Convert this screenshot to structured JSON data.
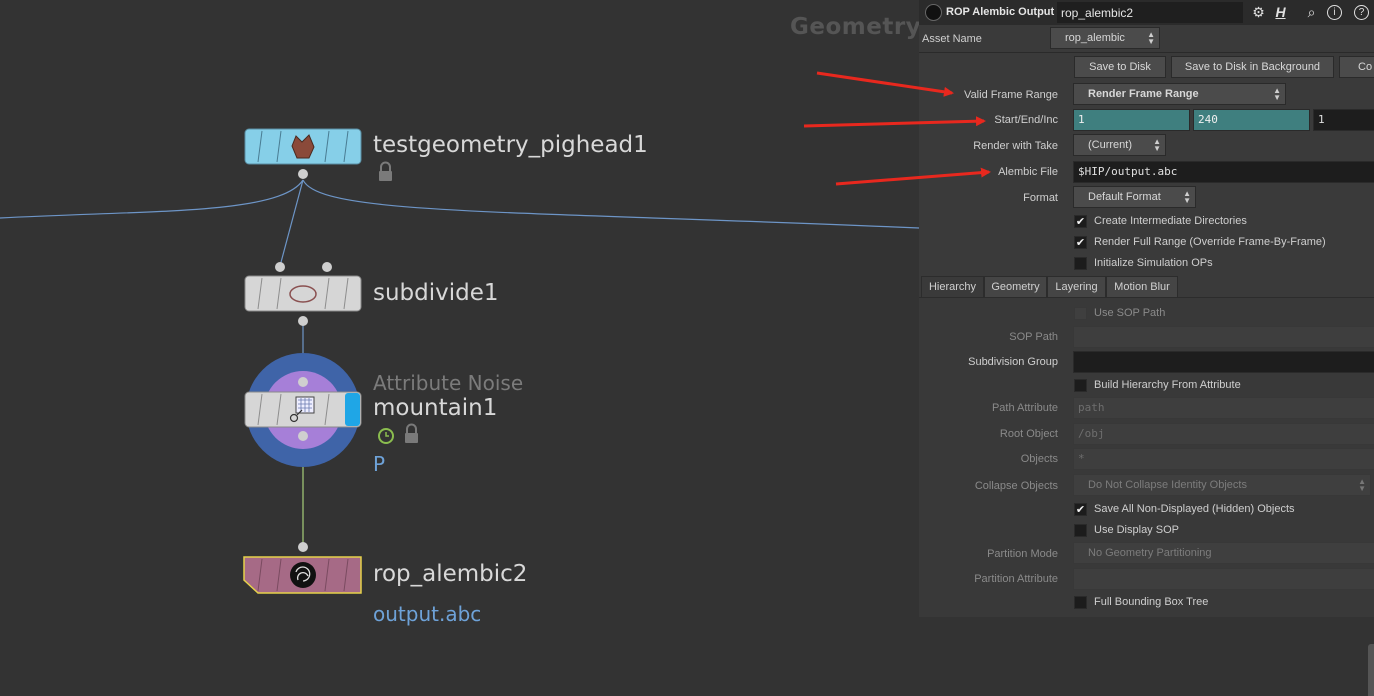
{
  "network": {
    "context": "Geometry",
    "nodes": {
      "pighead": {
        "name": "testgeometry_pighead1"
      },
      "subdivide": {
        "name": "subdivide1"
      },
      "mountain": {
        "type_label": "Attribute Noise",
        "name": "mountain1",
        "extra": "P"
      },
      "rop": {
        "name": "rop_alembic2",
        "extra": "output.abc"
      }
    },
    "colors": {
      "pighead_node": "#86cfe8",
      "default_node": "#d6d6d6",
      "rop_node": "#a66a86",
      "wire": "#6d95c7",
      "noise_ring_outer": "#3f64a8",
      "noise_ring_inner": "#a67fd8"
    }
  },
  "panel": {
    "header": {
      "type_label": "ROP Alembic Output",
      "node_name": "rop_alembic2"
    },
    "asset": {
      "label": "Asset Name",
      "value": "rop_alembic"
    },
    "buttons": {
      "save_to_disk": "Save to Disk",
      "save_background": "Save to Disk in Background",
      "controls": "Co"
    },
    "valid_frame_range": {
      "label": "Valid Frame Range",
      "value": "Render Frame Range"
    },
    "start_end_inc": {
      "label": "Start/End/Inc",
      "start": "1",
      "end": "240",
      "inc": "1"
    },
    "render_with_take": {
      "label": "Render with Take",
      "value": "(Current)"
    },
    "alembic_file": {
      "label": "Alembic File",
      "value": "$HIP/output.abc"
    },
    "format": {
      "label": "Format",
      "value": "Default Format"
    },
    "toggles": [
      {
        "label": "Create Intermediate Directories",
        "checked": true
      },
      {
        "label": "Render Full Range (Override Frame-By-Frame)",
        "checked": true
      },
      {
        "label": "Initialize Simulation OPs",
        "checked": false
      }
    ],
    "tabs": [
      "Hierarchy",
      "Geometry",
      "Layering",
      "Motion Blur"
    ],
    "hierarchy": {
      "use_sop_path": "Use SOP Path",
      "sop_path": "SOP Path",
      "subdivision_group": "Subdivision Group",
      "build_hierarchy": "Build Hierarchy From Attribute",
      "path_attribute": {
        "label": "Path Attribute",
        "value": "path"
      },
      "root_object": {
        "label": "Root Object",
        "value": "/obj"
      },
      "objects": {
        "label": "Objects",
        "value": "*"
      },
      "collapse_objects": {
        "label": "Collapse Objects",
        "value": "Do Not Collapse Identity Objects"
      },
      "save_hidden": "Save All Non-Displayed (Hidden) Objects",
      "use_display_sop": "Use Display SOP",
      "partition_mode": {
        "label": "Partition Mode",
        "value": "No Geometry Partitioning"
      },
      "partition_attribute": "Partition Attribute",
      "full_bounding_box": "Full Bounding Box Tree"
    }
  },
  "annotations": {
    "arrow_color": "#e8281e"
  }
}
